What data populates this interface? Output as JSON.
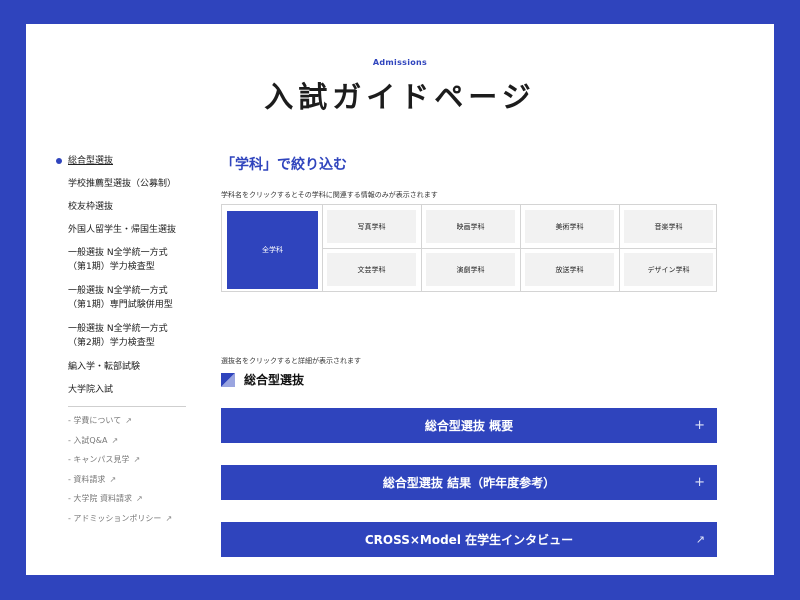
{
  "header": {
    "eyebrow": "Admissions",
    "title": "入試ガイドページ"
  },
  "sidebar": {
    "items": [
      {
        "label": "総合型選抜",
        "active": true
      },
      {
        "label": "学校推薦型選抜（公募制）"
      },
      {
        "label": "校友枠選抜"
      },
      {
        "label": "外国人留学生・帰国生選抜"
      },
      {
        "line1": "一般選抜 N全学統一方式",
        "line2": "（第1期）学力検査型"
      },
      {
        "line1": "一般選抜 N全学統一方式",
        "line2": "（第1期）専門試験併用型"
      },
      {
        "line1": "一般選抜 N全学統一方式",
        "line2": "（第2期）学力検査型"
      },
      {
        "label": "編入学・転部試験"
      },
      {
        "label": "大学院入試"
      }
    ],
    "links": [
      {
        "label": "- 学費について",
        "icon": "external-link-icon"
      },
      {
        "label": "- 入試Q&A",
        "icon": "external-link-icon"
      },
      {
        "label": "- キャンパス見学",
        "icon": "external-link-icon"
      },
      {
        "label": "- 資料請求",
        "icon": "external-link-icon"
      },
      {
        "label": "- 大学院 資料請求",
        "icon": "external-link-icon"
      },
      {
        "label": "- アドミッションポリシー",
        "icon": "external-link-icon"
      }
    ],
    "arrow_glyph": "↗"
  },
  "filter": {
    "heading": "「学科」で絞り込む",
    "help": "学科名をクリックするとその学科に関連する情報のみが表示されます",
    "all_label": "全学科",
    "departments": [
      "写真学科",
      "映画学科",
      "美術学科",
      "音楽学科",
      "文芸学科",
      "演劇学科",
      "放送学科",
      "デザイン学科"
    ]
  },
  "selection": {
    "help": "選抜名をクリックすると詳細が表示されます",
    "heading": "総合型選抜",
    "accordions": [
      {
        "label": "総合型選抜 概要",
        "icon": "+"
      },
      {
        "label": "総合型選抜 結果（昨年度参考）",
        "icon": "+"
      },
      {
        "label": "CROSS×Model 在学生インタビュー",
        "icon": "↗"
      }
    ]
  },
  "colors": {
    "brand": "#2f44bd",
    "cell_bg": "#f2f2f2",
    "grid_border": "#d4d4d4",
    "text": "#222222"
  }
}
